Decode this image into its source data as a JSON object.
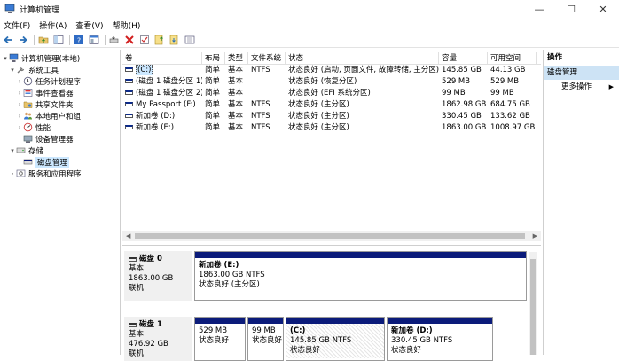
{
  "window": {
    "title": "计算机管理",
    "minimize": "—",
    "maximize": "☐",
    "close": "✕"
  },
  "menu": [
    "文件(F)",
    "操作(A)",
    "查看(V)",
    "帮助(H)"
  ],
  "tree": {
    "root": "计算机管理(本地)",
    "system_tools": "系统工具",
    "task_scheduler": "任务计划程序",
    "event_viewer": "事件查看器",
    "shared_folders": "共享文件夹",
    "local_users": "本地用户和组",
    "performance": "性能",
    "device_manager": "设备管理器",
    "storage": "存储",
    "disk_management": "磁盘管理",
    "services_apps": "服务和应用程序"
  },
  "volumes": {
    "headers": [
      "卷",
      "布局",
      "类型",
      "文件系统",
      "状态",
      "容量",
      "可用空间"
    ],
    "rows": [
      [
        "(C:)",
        "简单",
        "基本",
        "NTFS",
        "状态良好 (启动, 页面文件, 故障转储, 主分区)",
        "145.85 GB",
        "44.13 GB"
      ],
      [
        "(磁盘 1 磁盘分区 1)",
        "简单",
        "基本",
        "",
        "状态良好 (恢复分区)",
        "529 MB",
        "529 MB"
      ],
      [
        "(磁盘 1 磁盘分区 2)",
        "简单",
        "基本",
        "",
        "状态良好 (EFI 系统分区)",
        "99 MB",
        "99 MB"
      ],
      [
        "My Passport (F:)",
        "简单",
        "基本",
        "NTFS",
        "状态良好 (主分区)",
        "1862.98 GB",
        "684.75 GB"
      ],
      [
        "新加卷 (D:)",
        "简单",
        "基本",
        "NTFS",
        "状态良好 (主分区)",
        "330.45 GB",
        "133.62 GB"
      ],
      [
        "新加卷 (E:)",
        "简单",
        "基本",
        "NTFS",
        "状态良好 (主分区)",
        "1863.00 GB",
        "1008.97 GB"
      ]
    ]
  },
  "disks": {
    "disk0": {
      "name": "磁盘 0",
      "type": "基本",
      "size": "1863.00 GB",
      "status": "联机",
      "part": {
        "name": "新加卷 (E:)",
        "size": "1863.00 GB NTFS",
        "status": "状态良好 (主分区)"
      }
    },
    "disk1": {
      "name": "磁盘 1",
      "type": "基本",
      "size": "476.92 GB",
      "status": "联机",
      "parts": [
        {
          "name": "",
          "size": "529 MB",
          "status": "状态良好"
        },
        {
          "name": "",
          "size": "99 MB",
          "status": "状态良好"
        },
        {
          "name": "(C:)",
          "size": "145.85 GB NTFS",
          "status": "状态良好"
        },
        {
          "name": "新加卷 (D:)",
          "size": "330.45 GB NTFS",
          "status": "状态良好"
        }
      ]
    }
  },
  "actions": {
    "header": "操作",
    "section": "磁盘管理",
    "more": "更多操作"
  },
  "colors": {
    "accent": "#0b1b7a",
    "selection": "#cce8ff",
    "action_section": "#cde3f5"
  }
}
